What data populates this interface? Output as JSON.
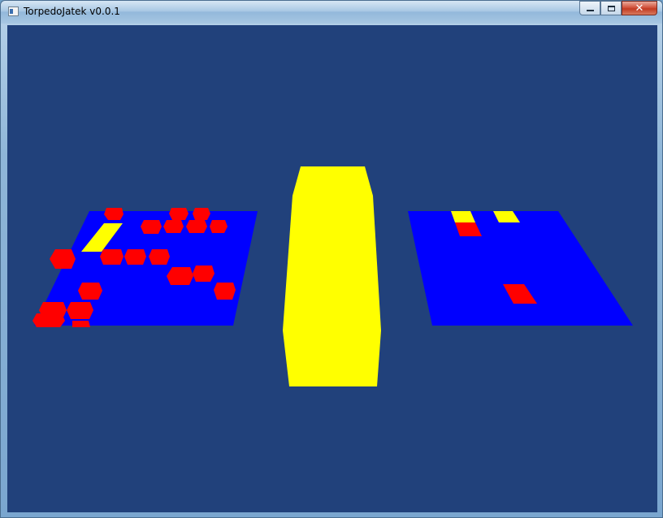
{
  "window": {
    "title": "TorpedoJatek v0.0.1",
    "controls": {
      "minimize_icon": "minimize-icon",
      "maximize_icon": "maximize-icon",
      "close_glyph": "✕"
    }
  },
  "scene": {
    "background_color": "#21417b",
    "board_color": "#0000ff",
    "ship_color": "#ff0000",
    "marker_color": "#ffff00",
    "divider_color": "#ffff00"
  }
}
